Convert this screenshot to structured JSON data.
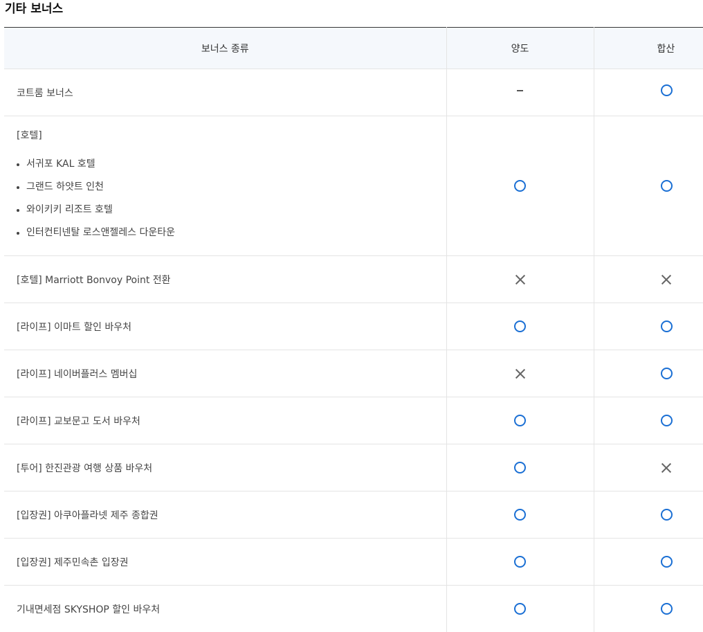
{
  "section": {
    "title": "기타 보너스"
  },
  "table": {
    "headers": [
      "보너스 종류",
      "양도",
      "합산"
    ],
    "rows": [
      {
        "name": "코트룸 보너스",
        "transfer": "dash",
        "combine": "circle"
      },
      {
        "name": "[호텔]",
        "sub_items": [
          "서귀포 KAL 호텔",
          "그랜드 하얏트 인천",
          "와이키키 리조트 호텔",
          "인터컨티넨탈 로스앤젤레스 다운타운"
        ],
        "transfer": "circle",
        "combine": "circle"
      },
      {
        "name": "[호텔] Marriott Bonvoy Point 전환",
        "transfer": "cross",
        "combine": "cross"
      },
      {
        "name": "[라이프] 이마트 할인 바우처",
        "transfer": "circle",
        "combine": "circle"
      },
      {
        "name": "[라이프] 네이버플러스 멤버십",
        "transfer": "cross",
        "combine": "circle"
      },
      {
        "name": "[라이프] 교보문고 도서 바우처",
        "transfer": "circle",
        "combine": "circle"
      },
      {
        "name": "[투어] 한진관광 여행 상품 바우처",
        "transfer": "circle",
        "combine": "cross"
      },
      {
        "name": "[입장권] 아쿠아플라넷 제주 종합권",
        "transfer": "circle",
        "combine": "circle"
      },
      {
        "name": "[입장권] 제주민속촌 입장권",
        "transfer": "circle",
        "combine": "circle"
      },
      {
        "name": "기내면세점 SKYSHOP 할인 바우처",
        "transfer": "circle",
        "combine": "circle"
      }
    ]
  },
  "icons": {
    "circle": "circle-mark-icon",
    "cross": "cross-mark-icon",
    "dash": "dash-mark-icon"
  },
  "colors": {
    "circle": "#1a6fd4",
    "cross": "#666666",
    "header_bg": "#f5f8fc"
  }
}
